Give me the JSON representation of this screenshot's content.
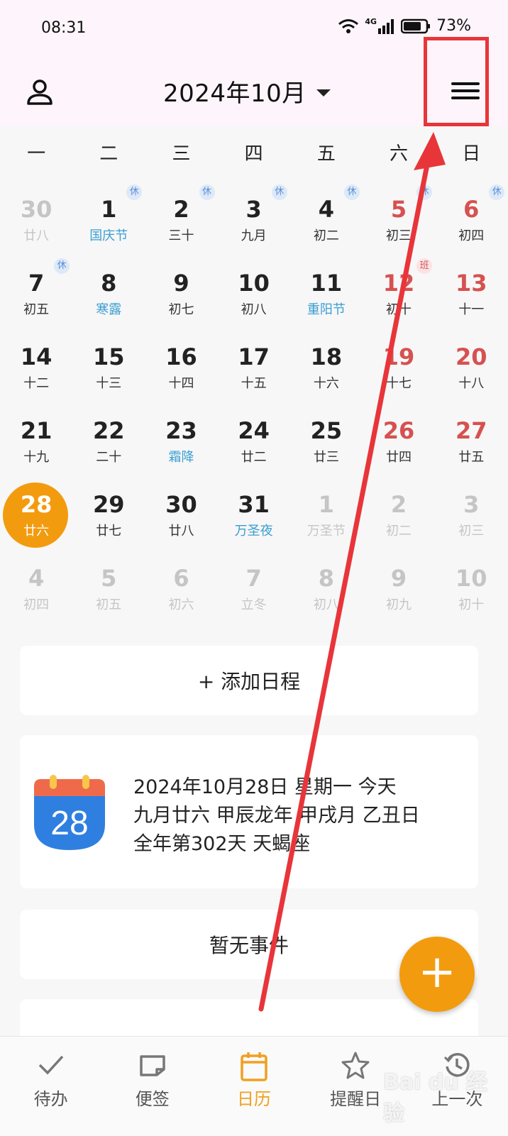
{
  "status_bar": {
    "time": "08:31",
    "network": "4G",
    "battery": "73%"
  },
  "header": {
    "title": "2024年10月"
  },
  "weekdays": [
    "一",
    "二",
    "三",
    "四",
    "五",
    "六",
    "日"
  ],
  "calendar": {
    "rows": [
      [
        {
          "day": "30",
          "lunar": "廿八",
          "other": true
        },
        {
          "day": "1",
          "lunar": "国庆节",
          "holiday": true,
          "badge": "休"
        },
        {
          "day": "2",
          "lunar": "三十",
          "badge": "休"
        },
        {
          "day": "3",
          "lunar": "九月",
          "badge": "休"
        },
        {
          "day": "4",
          "lunar": "初二",
          "badge": "休"
        },
        {
          "day": "5",
          "lunar": "初三",
          "weekend": true,
          "badge": "休"
        },
        {
          "day": "6",
          "lunar": "初四",
          "weekend": true,
          "badge": "休"
        }
      ],
      [
        {
          "day": "7",
          "lunar": "初五",
          "badge": "休"
        },
        {
          "day": "8",
          "lunar": "寒露",
          "holiday": true
        },
        {
          "day": "9",
          "lunar": "初七"
        },
        {
          "day": "10",
          "lunar": "初八"
        },
        {
          "day": "11",
          "lunar": "重阳节",
          "holiday": true
        },
        {
          "day": "12",
          "lunar": "初十",
          "weekend": true,
          "badge": "班",
          "badge_type": "work"
        },
        {
          "day": "13",
          "lunar": "十一",
          "weekend": true
        }
      ],
      [
        {
          "day": "14",
          "lunar": "十二"
        },
        {
          "day": "15",
          "lunar": "十三"
        },
        {
          "day": "16",
          "lunar": "十四"
        },
        {
          "day": "17",
          "lunar": "十五"
        },
        {
          "day": "18",
          "lunar": "十六"
        },
        {
          "day": "19",
          "lunar": "十七",
          "weekend": true
        },
        {
          "day": "20",
          "lunar": "十八",
          "weekend": true
        }
      ],
      [
        {
          "day": "21",
          "lunar": "十九"
        },
        {
          "day": "22",
          "lunar": "二十"
        },
        {
          "day": "23",
          "lunar": "霜降",
          "holiday": true
        },
        {
          "day": "24",
          "lunar": "廿二"
        },
        {
          "day": "25",
          "lunar": "廿三"
        },
        {
          "day": "26",
          "lunar": "廿四",
          "weekend": true
        },
        {
          "day": "27",
          "lunar": "廿五",
          "weekend": true
        }
      ],
      [
        {
          "day": "28",
          "lunar": "廿六",
          "today": true
        },
        {
          "day": "29",
          "lunar": "廿七"
        },
        {
          "day": "30",
          "lunar": "廿八"
        },
        {
          "day": "31",
          "lunar": "万圣夜",
          "holiday": true
        },
        {
          "day": "1",
          "lunar": "万圣节",
          "other": true,
          "holiday": true
        },
        {
          "day": "2",
          "lunar": "初二",
          "other": true
        },
        {
          "day": "3",
          "lunar": "初三",
          "other": true
        }
      ],
      [
        {
          "day": "4",
          "lunar": "初四",
          "other": true
        },
        {
          "day": "5",
          "lunar": "初五",
          "other": true
        },
        {
          "day": "6",
          "lunar": "初六",
          "other": true
        },
        {
          "day": "7",
          "lunar": "立冬",
          "other": true
        },
        {
          "day": "8",
          "lunar": "初八",
          "other": true
        },
        {
          "day": "9",
          "lunar": "初九",
          "other": true
        },
        {
          "day": "10",
          "lunar": "初十",
          "other": true
        }
      ]
    ]
  },
  "add_schedule": {
    "label": "+ 添加日程"
  },
  "today_info": {
    "icon_day": "28",
    "line1": "2024年10月28日 星期一 今天",
    "line2": "九月廿六 甲辰龙年 甲戌月 乙丑日",
    "line3": "全年第302天 天蝎座"
  },
  "events": {
    "empty_text": "暂无事件"
  },
  "fab": {
    "label": "+"
  },
  "bottom_nav": [
    {
      "label": "待办",
      "icon": "check-icon"
    },
    {
      "label": "便签",
      "icon": "note-icon"
    },
    {
      "label": "日历",
      "icon": "calendar-icon",
      "active": true
    },
    {
      "label": "提醒日",
      "icon": "star-icon"
    },
    {
      "label": "上一次",
      "icon": "history-icon"
    }
  ],
  "colors": {
    "accent": "#f39b0e",
    "weekend": "#d65151",
    "holiday": "#3a9ed1",
    "annotation": "#e8353a"
  },
  "watermark": "Bai du 经验"
}
